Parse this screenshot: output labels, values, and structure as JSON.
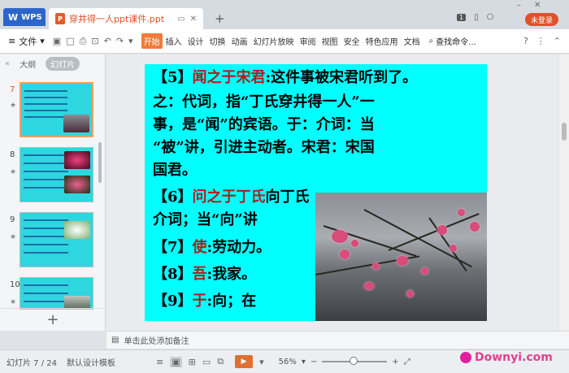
{
  "window": {
    "app_tab": "WPS",
    "doc_tab_title": "穿井得一人ppt课件.ppt",
    "login_button": "未登录",
    "badge": "1"
  },
  "ribbon": {
    "menu_label": "文件",
    "tabs": [
      "开始",
      "插入",
      "设计",
      "切换",
      "动画",
      "幻灯片放映",
      "审阅",
      "视图",
      "安全",
      "特色应用",
      "文档"
    ],
    "active_tab": "开始",
    "search_label": "查找命令..."
  },
  "left_panel": {
    "views": [
      "大纲",
      "幻灯片"
    ],
    "active_view": "幻灯片",
    "slide_numbers": [
      "7",
      "8",
      "9",
      "10"
    ],
    "active_slide": "7"
  },
  "slide": {
    "lines": [
      {
        "num": "【5】",
        "red": "闻之于宋君",
        "black": ":这件事被宋君听到了。"
      },
      {
        "num": "",
        "red": "",
        "black": "之：代词，指“丁氏穿井得一人”一"
      },
      {
        "num": "",
        "red": "",
        "black": "事，是“闻”的宾语。于：介词：当"
      },
      {
        "num": "",
        "red": "",
        "black": "“被”讲，引进主动者。宋君：宋国"
      },
      {
        "num": "",
        "red": "",
        "black": "国君。"
      },
      {
        "num": "【6】",
        "red": "问之于丁氏",
        "black": "向丁氏"
      },
      {
        "num": "",
        "red": "",
        "black": "介词；当“向”讲"
      },
      {
        "num": "【7】",
        "red": "使",
        "black": ":劳动力。"
      },
      {
        "num": "【8】",
        "red": "吾",
        "black": ":我家。"
      },
      {
        "num": "【9】",
        "red": "于",
        "black": ":向；在"
      }
    ]
  },
  "notes": {
    "placeholder": "单击此处添加备注"
  },
  "statusbar": {
    "slide_counter": "幻灯片 7 / 24",
    "design_template": "默认设计模板",
    "zoom": "56%"
  },
  "watermark": "Downyi.com",
  "colors": {
    "slide_bg": "#00ffff",
    "highlight_red": "#b31b1b",
    "accent_orange": "#f07b3a",
    "brand_blue": "#2d64c8"
  }
}
